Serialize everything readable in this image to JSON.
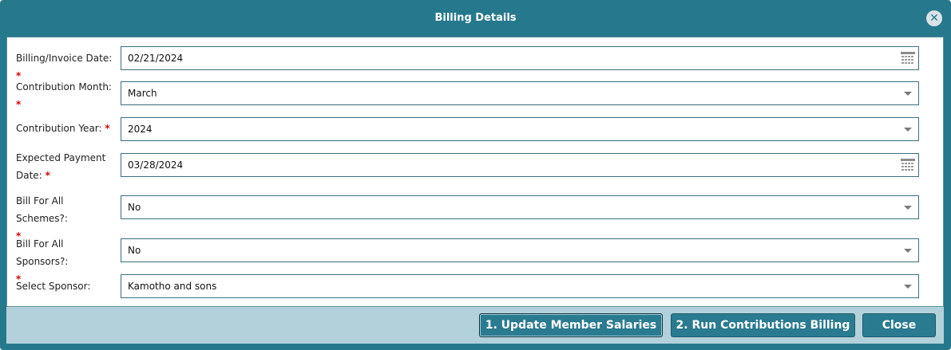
{
  "dialog": {
    "title": "Billing Details"
  },
  "form": {
    "required_mark": "*",
    "billing_date": {
      "label": "Billing/Invoice Date:",
      "value": "02/21/2024"
    },
    "contribution_month": {
      "label": "Contribution Month:",
      "value": "March"
    },
    "contribution_year": {
      "label": "Contribution Year:",
      "value": "2024"
    },
    "expected_payment_date": {
      "label": "Expected Payment Date:",
      "value": "03/28/2024"
    },
    "bill_all_schemes": {
      "label": "Bill For All Schemes?:",
      "value": "No"
    },
    "bill_all_sponsors": {
      "label": "Bill For All Sponsors?:",
      "value": "No"
    },
    "select_sponsor": {
      "label": "Select Sponsor:",
      "value": "Kamotho and sons"
    }
  },
  "footer": {
    "update_salaries_label": "1. Update Member Salaries",
    "run_billing_label": "2. Run Contributions Billing",
    "close_label": "Close"
  },
  "colors": {
    "accent": "#26788d",
    "footer_bg": "#b3d1da",
    "required": "#d40000"
  }
}
